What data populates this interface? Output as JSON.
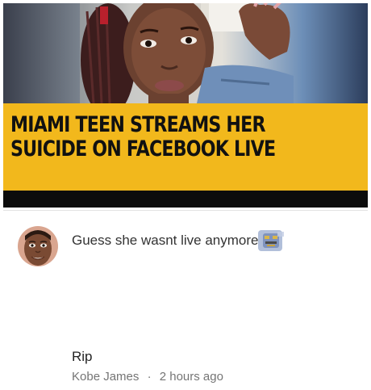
{
  "post": {
    "headline_line1": "MIAMI TEEN STREAMS HER",
    "headline_line2": "SUICIDE ON FACEBOOK LIVE",
    "banner_color": "#f2b81c"
  },
  "comment": {
    "text": "Guess she wasnt live anymore",
    "emoji_icon": "pixelated-face-icon"
  },
  "reply": {
    "text": "Rip",
    "author": "Kobe James",
    "separator": "·",
    "time": "2 hours ago"
  }
}
